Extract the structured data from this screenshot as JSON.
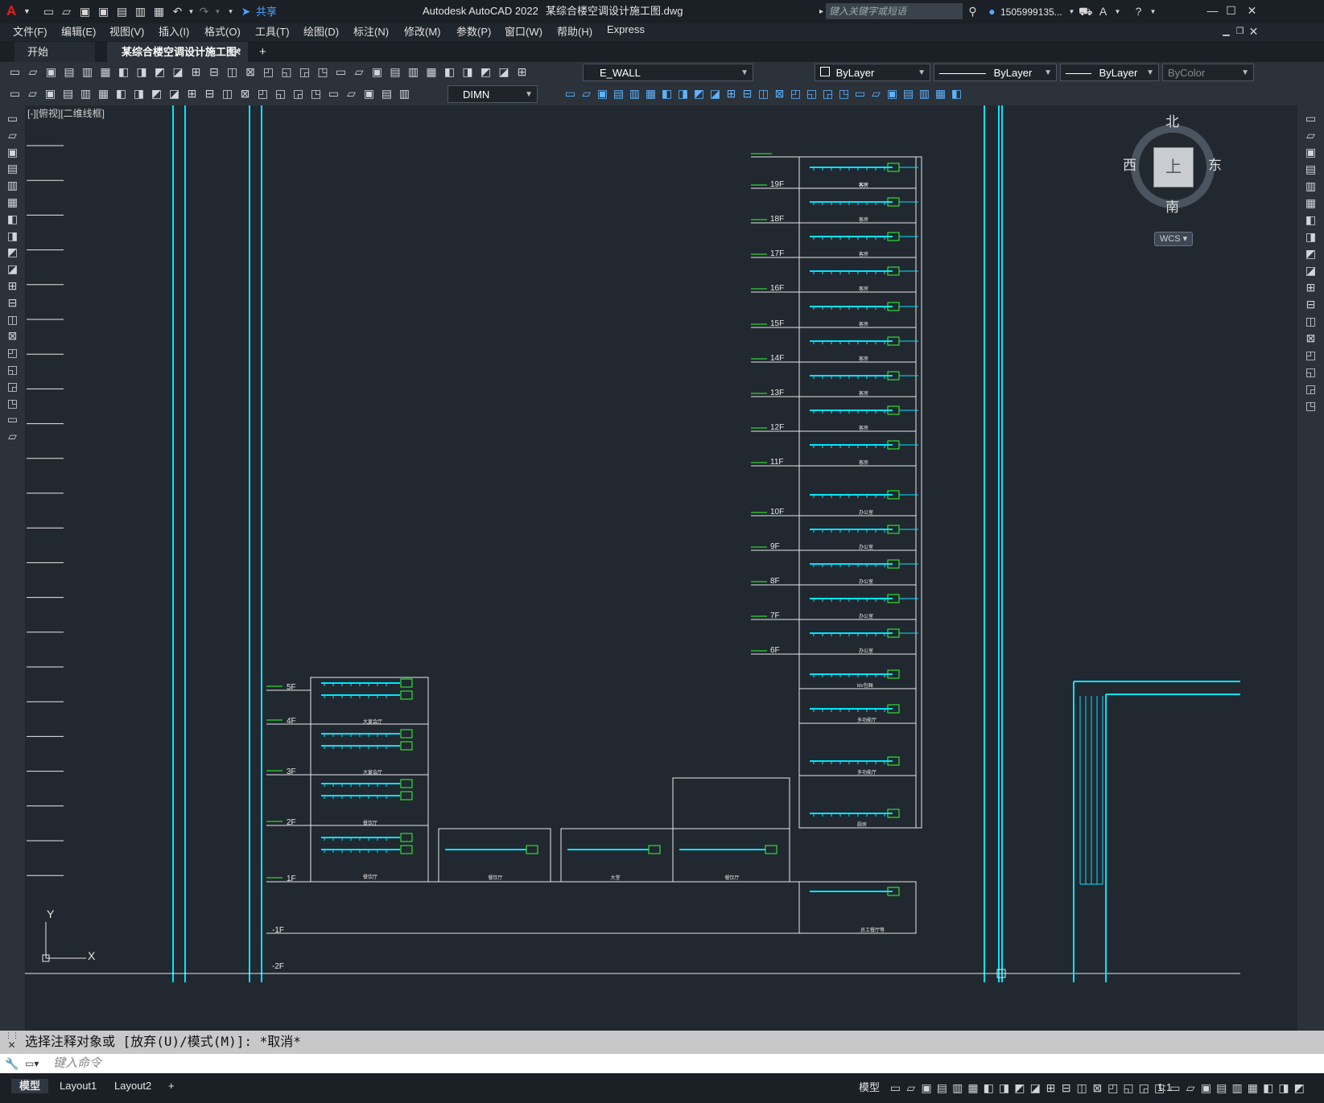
{
  "app": {
    "logo": "A",
    "title": "Autodesk AutoCAD 2022",
    "file": "某综合楼空调设计施工图.dwg",
    "share": "共享",
    "search_placeholder": "键入关键字或短语",
    "user": "1505999135...",
    "window_controls": [
      "minimize-icon",
      "maximize-icon",
      "close-icon"
    ]
  },
  "menu": [
    "文件(F)",
    "编辑(E)",
    "视图(V)",
    "插入(I)",
    "格式(O)",
    "工具(T)",
    "绘图(D)",
    "标注(N)",
    "修改(M)",
    "参数(P)",
    "窗口(W)",
    "帮助(H)",
    "Express"
  ],
  "tabs": {
    "start": "开始",
    "active": "某综合楼空调设计施工图*",
    "add": "+"
  },
  "toolbar1": {
    "layer": "E_WALL",
    "color": "ByLayer",
    "linetype": "ByLayer",
    "lineweight": "ByLayer",
    "plotstyle": "ByColor"
  },
  "toolbar2": {
    "dimstyle": "DIMN"
  },
  "viewport": {
    "label": "[-][俯视][二维线框]",
    "viewcube": {
      "north": "北",
      "south": "南",
      "east": "东",
      "west": "西",
      "top": "上",
      "wcs": "WCS"
    },
    "ucs": {
      "x": "X",
      "y": "Y"
    }
  },
  "drawing": {
    "floor_labels": [
      "19F",
      "18F",
      "17F",
      "16F",
      "15F",
      "14F",
      "13F",
      "12F",
      "11F",
      "10F",
      "9F",
      "8F",
      "7F",
      "6F",
      "5F",
      "4F",
      "3F",
      "2F",
      "1F",
      "-1F",
      "-2F"
    ],
    "room_labels": {
      "upper_guest": "客房",
      "office": "办公室",
      "ktv": "ktv包厢",
      "multi": "多功能厅",
      "banquet": "大宴会厅",
      "dining": "餐饮厅",
      "lobby": "大堂",
      "kitchen": "厨房",
      "basement": "员工餐厅等"
    }
  },
  "command": {
    "history": "选择注释对象或 [放弃(U)/模式(M)]: *取消*",
    "placeholder": "键入命令"
  },
  "layout_tabs": [
    "模型",
    "Layout1",
    "Layout2",
    "+"
  ],
  "status": {
    "model": "模型",
    "scale": "1:1"
  }
}
